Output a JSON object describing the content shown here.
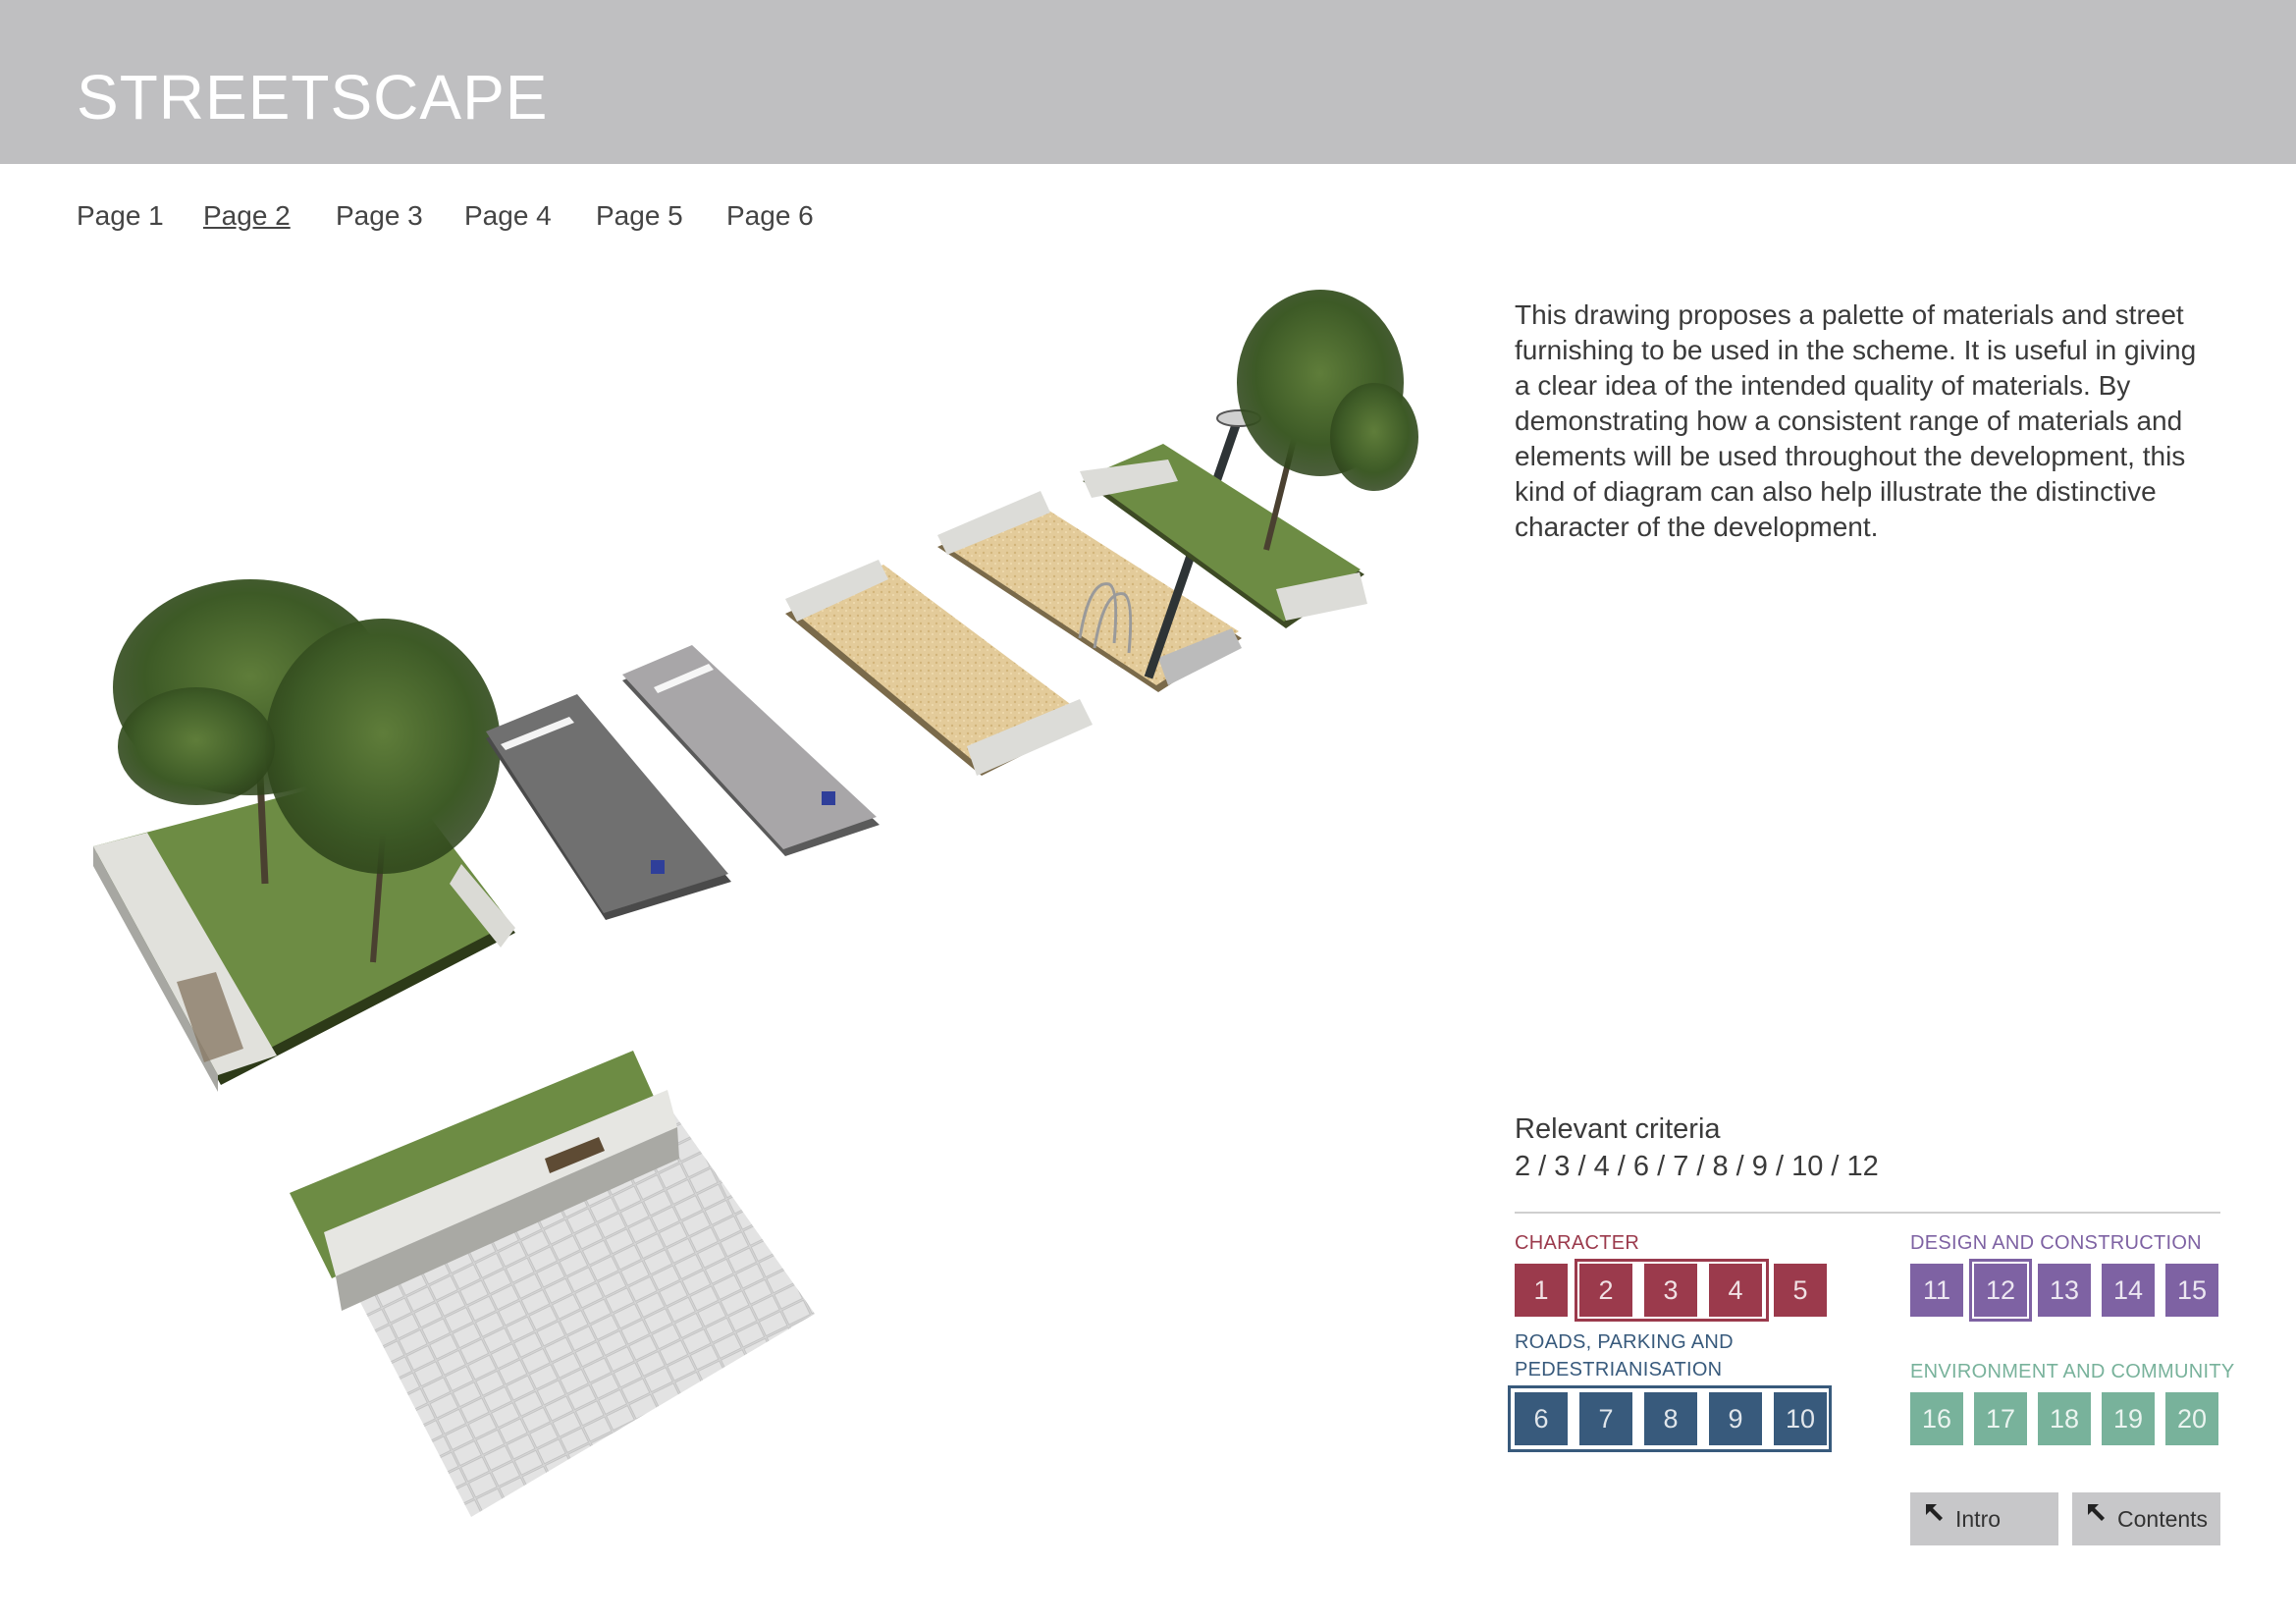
{
  "header": {
    "title": "STREETSCAPE"
  },
  "pager": {
    "items": [
      {
        "label": "Page 1",
        "active": false
      },
      {
        "label": "Page 2",
        "active": true
      },
      {
        "label": "Page 3",
        "active": false
      },
      {
        "label": "Page 4",
        "active": false
      },
      {
        "label": "Page 5",
        "active": false
      },
      {
        "label": "Page 6",
        "active": false
      }
    ]
  },
  "description": "This drawing proposes a palette of materials and street furnishing to be used in the scheme. It is useful in giving a clear idea of the intended quality of materials. By demonstrating how a consistent range of materials and elements will be used throughout the development, this kind of diagram can also help illustrate the distinctive character of the development.",
  "criteria": {
    "label": "Relevant criteria",
    "list": "2 / 3 / 4 / 6 / 7 / 8 / 9 / 10 / 12"
  },
  "categories": {
    "character": {
      "label": "CHARACTER",
      "color": "#9b3a4c",
      "numbers": [
        "1",
        "2",
        "3",
        "4",
        "5"
      ],
      "selected": [
        "2",
        "3",
        "4"
      ]
    },
    "design": {
      "label": "DESIGN AND CONSTRUCTION",
      "color": "#7e62a3",
      "numbers": [
        "11",
        "12",
        "13",
        "14",
        "15"
      ],
      "selected": [
        "12"
      ]
    },
    "roads": {
      "label_line1": "ROADS, PARKING AND",
      "label_line2": "PEDESTRIANISATION",
      "color": "#385a7c",
      "numbers": [
        "6",
        "7",
        "8",
        "9",
        "10"
      ],
      "selected": [
        "6",
        "7",
        "8",
        "9",
        "10"
      ]
    },
    "environment": {
      "label": "ENVIRONMENT AND COMMUNITY",
      "color": "#78b29b",
      "numbers": [
        "16",
        "17",
        "18",
        "19",
        "20"
      ],
      "selected": []
    }
  },
  "nav": {
    "intro_label": "Intro",
    "contents_label": "Contents",
    "arrow_icon": "arrow-up-left-icon"
  }
}
